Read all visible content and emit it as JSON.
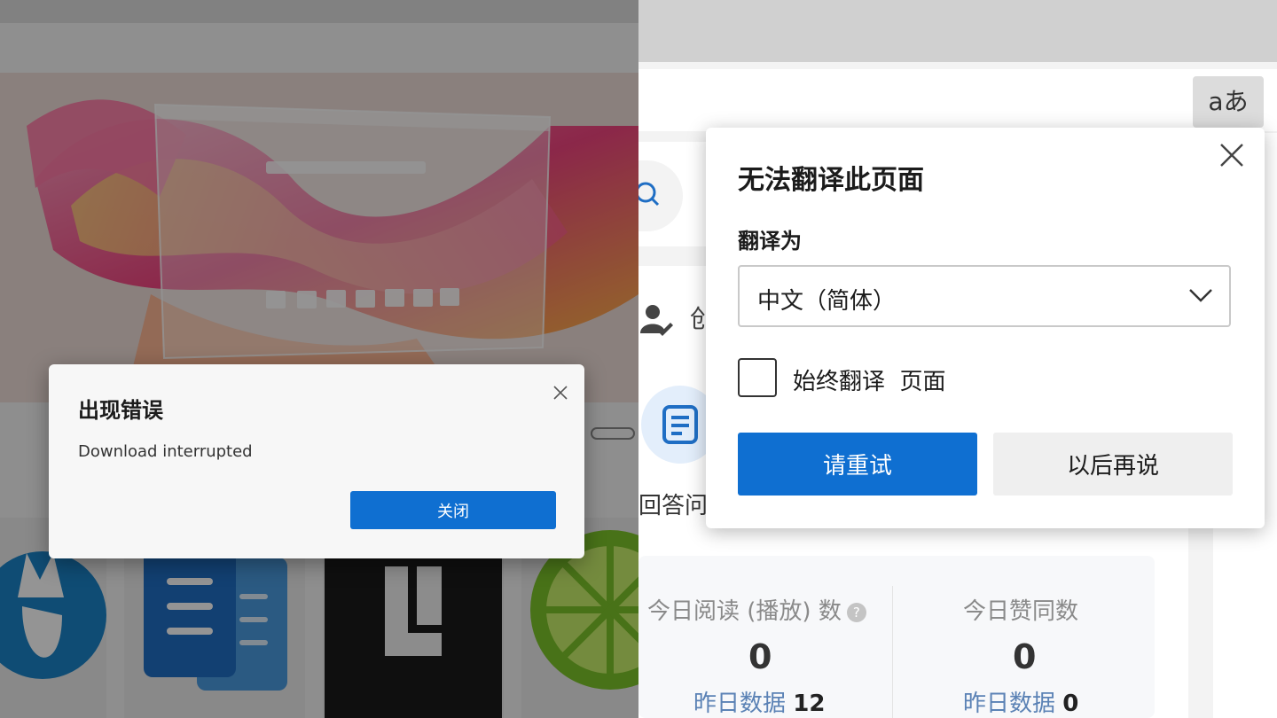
{
  "left": {
    "error_dialog": {
      "title": "出现错误",
      "message": "Download interrupted",
      "close_button_label": "关闭"
    }
  },
  "right": {
    "translate_toolbar_icon": "aあ",
    "page": {
      "create_label": "创",
      "answer_label": "回答问",
      "stats": [
        {
          "label": "今日阅读 (播放) 数",
          "value": "0",
          "sub_label": "昨日数据",
          "sub_value": "12"
        },
        {
          "label": "今日赞同数",
          "value": "0",
          "sub_label": "昨日数据",
          "sub_value": "0"
        }
      ]
    },
    "translate_dialog": {
      "title": "无法翻译此页面",
      "translate_to_label": "翻译为",
      "selected_language": "中文（简体）",
      "always_translate_label": "始终翻译  页面",
      "always_translate_checked": false,
      "retry_button": "请重试",
      "later_button": "以后再说"
    }
  },
  "colors": {
    "primary_blue": "#0f6fd1",
    "stat_link_blue": "#5b82b5",
    "dim_overlay": "rgba(0,0,0,0.42)"
  }
}
